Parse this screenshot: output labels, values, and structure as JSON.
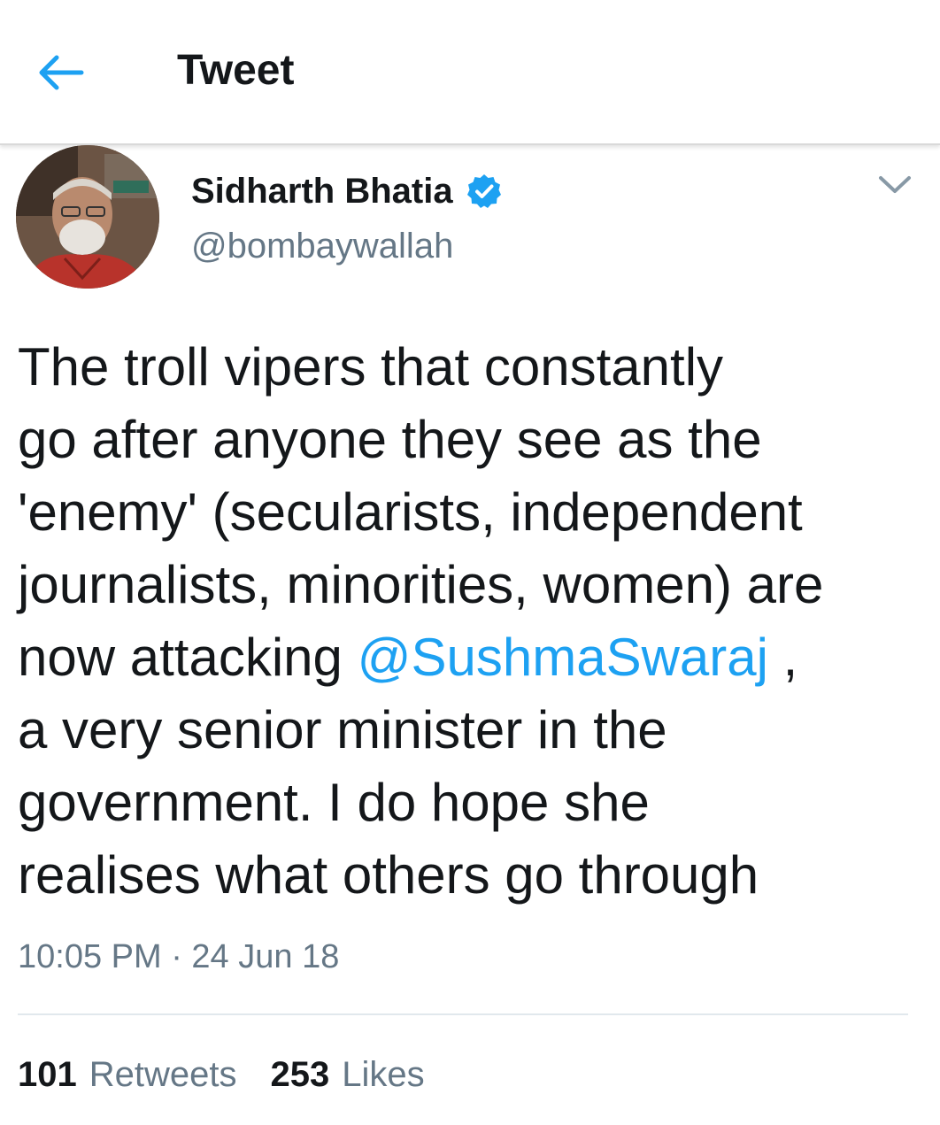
{
  "header": {
    "title": "Tweet",
    "back_icon": "arrow-left-icon"
  },
  "author": {
    "name": "Sidharth Bhatia",
    "handle": "@bombaywallah",
    "verified_icon": "verified-badge-icon"
  },
  "tweet": {
    "text_parts": {
      "before_mention": "The troll vipers that constantly\ngo after anyone they see as the\n'enemy' (secularists, independent\njournalists, minorities, women) are\nnow attacking ",
      "mention": "@SushmaSwaraj",
      "after_mention": " ,\na very senior minister in the\ngovernment. I do hope she\nrealises what others go through"
    },
    "timestamp": "10:05 PM · 24 Jun 18"
  },
  "stats": {
    "retweets_count": "101",
    "retweets_label": "Retweets",
    "likes_count": "253",
    "likes_label": "Likes"
  },
  "colors": {
    "accent": "#1da1f2",
    "text_primary": "#14171a",
    "text_secondary": "#657786"
  }
}
